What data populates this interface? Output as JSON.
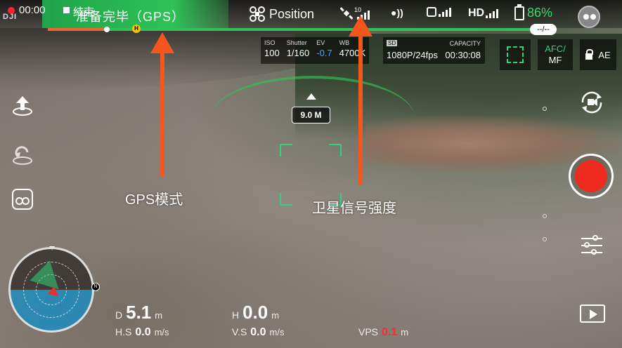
{
  "topbar": {
    "logo": "DJI",
    "rec_time": "00:00",
    "end_label": "结束",
    "flight_status": "准备完毕（GPS）",
    "mode": "Position",
    "satellite_count": "10",
    "hd_label": "HD",
    "battery_percent": "86%",
    "time_remaining": "--/--"
  },
  "camera": {
    "iso_label": "ISO",
    "iso_value": "100",
    "shutter_label": "Shutter",
    "shutter_value": "1/160",
    "ev_label": "EV",
    "ev_value": "-0.7",
    "wb_label": "WB",
    "wb_value": "4700K",
    "sd_label": "SD",
    "resolution": "1080P/24fps",
    "capacity_label": "CAPACITY",
    "capacity_value": "00:30:08",
    "afc_label": "AFC/",
    "mf_label": "MF",
    "ae_label": "AE"
  },
  "overlay": {
    "distance_badge": "9.0 M"
  },
  "annotations": {
    "gps_mode": "GPS模式",
    "satellite_strength": "卫星信号强度"
  },
  "telemetry": {
    "d_label": "D",
    "d_value": "5.1",
    "d_unit": "m",
    "h_label": "H",
    "h_value": "0.0",
    "h_unit": "m",
    "hs_label": "H.S",
    "hs_value": "0.0",
    "hs_unit": "m/s",
    "vs_label": "V.S",
    "vs_value": "0.0",
    "vs_unit": "m/s",
    "vps_label": "VPS",
    "vps_value": "0.1",
    "vps_unit": "m"
  },
  "radar": {
    "north_label": "N"
  },
  "colors": {
    "accent_green": "#2fc257",
    "battery_green": "#3fd872",
    "record_red": "#ee2a1e",
    "annotation_orange": "#f4561c",
    "ev_blue": "#46a4ff"
  }
}
